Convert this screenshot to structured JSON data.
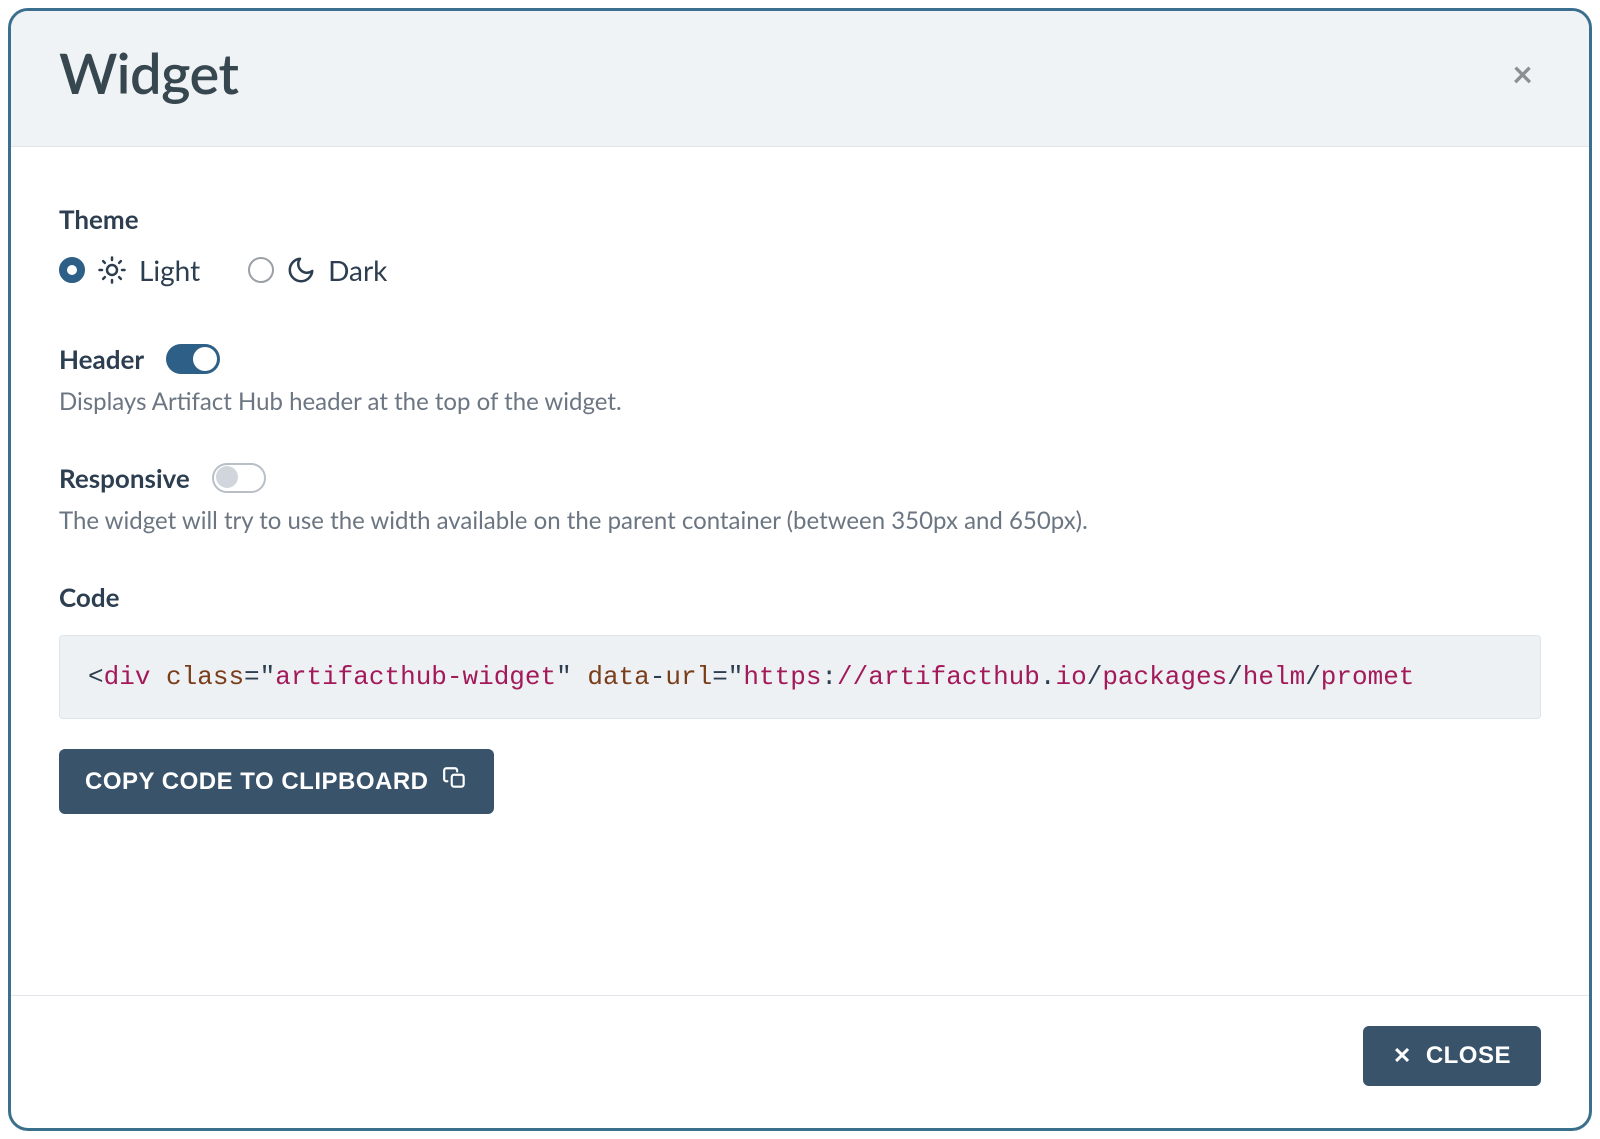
{
  "modal": {
    "title": "Widget",
    "close_icon": "×"
  },
  "theme": {
    "label": "Theme",
    "options": [
      {
        "id": "light",
        "label": "Light",
        "selected": true,
        "icon": "sun-icon"
      },
      {
        "id": "dark",
        "label": "Dark",
        "selected": false,
        "icon": "moon-icon"
      }
    ]
  },
  "header_toggle": {
    "label": "Header",
    "value": true,
    "help": "Displays Artifact Hub header at the top of the widget."
  },
  "responsive_toggle": {
    "label": "Responsive",
    "value": false,
    "help": "The widget will try to use the width available on the parent container (between 350px and 650px)."
  },
  "code": {
    "label": "Code",
    "tokens": {
      "lt": "<",
      "tag": "div",
      "sp1": " ",
      "attr_class": "class",
      "eq1": "=\"",
      "val_class": "artifacthub-widget",
      "q1": "\"",
      "sp2": "  ",
      "attr_data": "data",
      "dash": "-",
      "attr_url": "url",
      "eq2": "=\"",
      "val_proto": "https",
      "colon": ":",
      "slashslash": "//",
      "host1": "artifacthub",
      "dot1": ".",
      "host2": "io",
      "slash1": "/",
      "seg1": "packages",
      "slash2": "/",
      "seg2": "helm",
      "slash3": "/",
      "seg3": "promet"
    },
    "copy_label": "COPY CODE TO CLIPBOARD"
  },
  "footer": {
    "close_label": "CLOSE"
  }
}
